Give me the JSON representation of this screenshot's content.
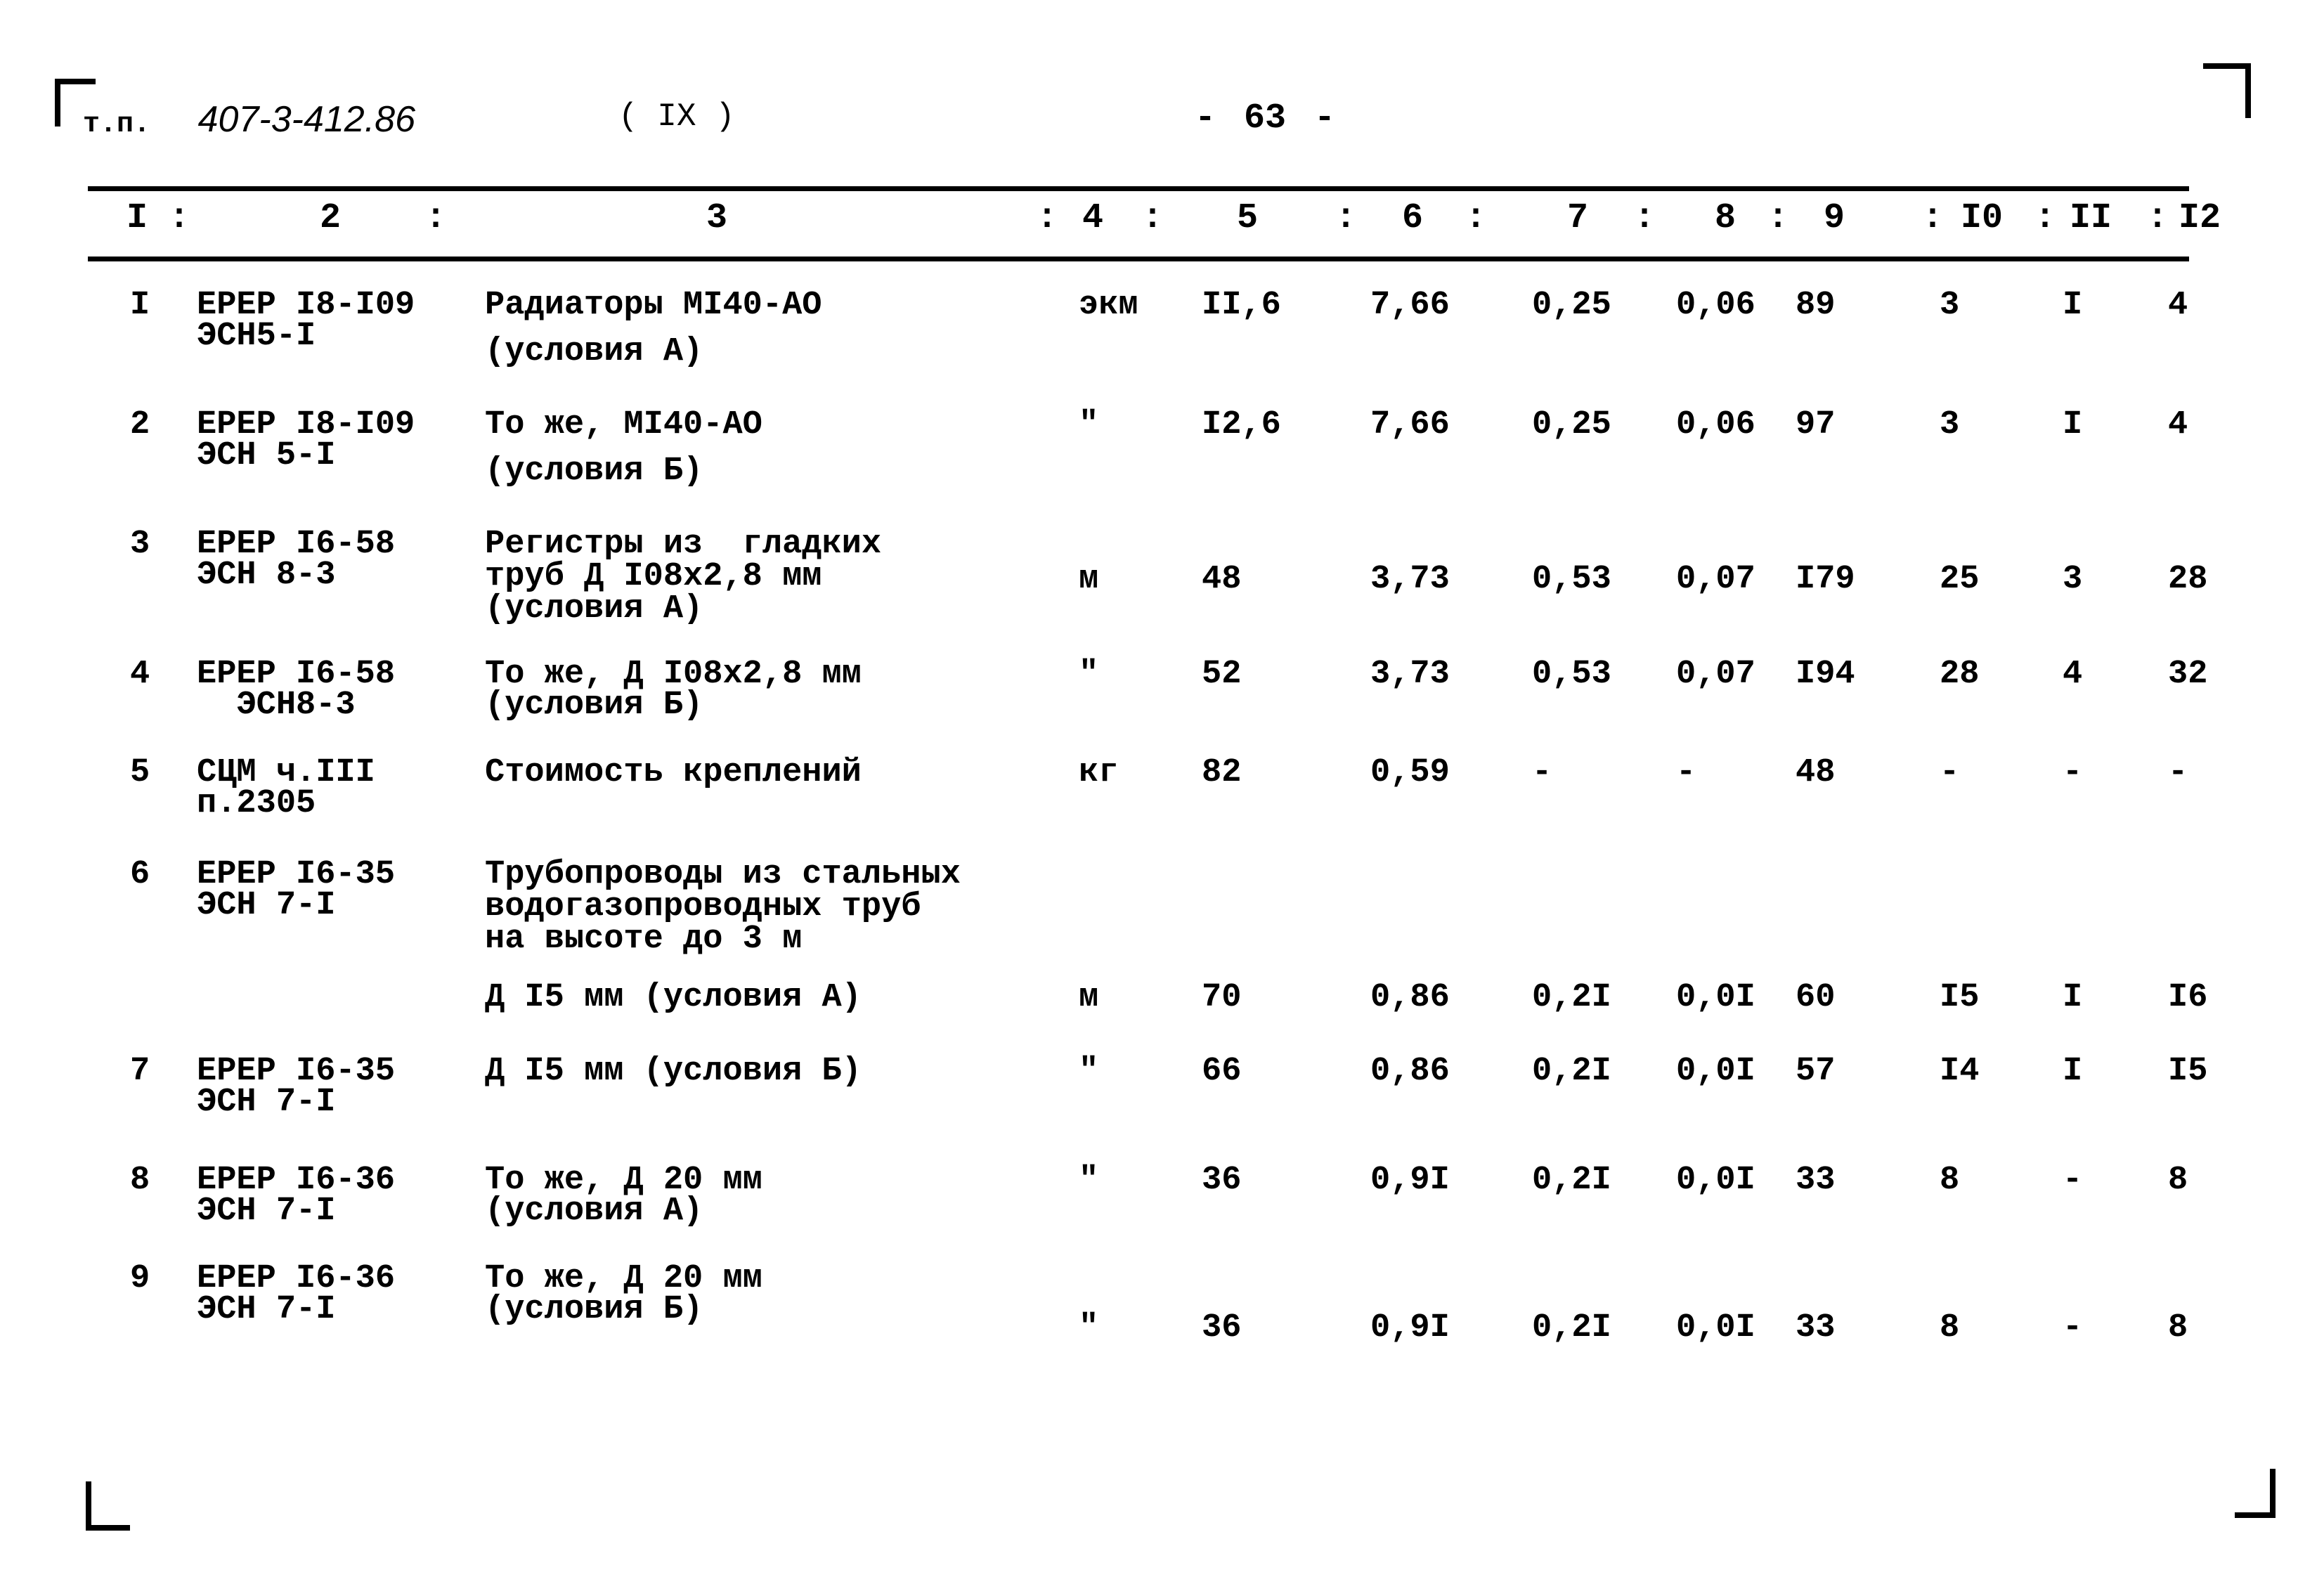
{
  "header": {
    "doc_prefix": "т.п.",
    "doc_number": "407-3-412.86",
    "section": "( IX )",
    "page_number": "63",
    "dash": "-"
  },
  "table": {
    "columns": [
      "I",
      "2",
      "3",
      "4",
      "5",
      "6",
      "7",
      "8",
      "9",
      "I0",
      "II",
      "I2"
    ],
    "column_separator": ":",
    "rows": [
      {
        "n": "I",
        "ref": [
          "ЕРЕР I8-I09",
          "ЭСН5-I"
        ],
        "desc": [
          "Радиаторы МI40-АО",
          "(условия А)"
        ],
        "unit": "экм",
        "c5": "II,6",
        "c6": "7,66",
        "c7": "0,25",
        "c8": "0,06",
        "c9": "89",
        "c10": "3",
        "c11": "I",
        "c12": "4"
      },
      {
        "n": "2",
        "ref": [
          "ЕРЕР I8-I09",
          "ЭСН 5-I"
        ],
        "desc": [
          "То же, МI40-АО",
          "(условия Б)"
        ],
        "unit": "\"",
        "c5": "I2,6",
        "c6": "7,66",
        "c7": "0,25",
        "c8": "0,06",
        "c9": "97",
        "c10": "3",
        "c11": "I",
        "c12": "4"
      },
      {
        "n": "3",
        "ref": [
          "ЕРЕР I6-58",
          "ЭСН 8-3"
        ],
        "desc": [
          "Регистры из  гладких",
          "труб Д I08x2,8 мм",
          "(условия А)"
        ],
        "unit": "м",
        "c5": "48",
        "c6": "3,73",
        "c7": "0,53",
        "c8": "0,07",
        "c9": "I79",
        "c10": "25",
        "c11": "3",
        "c12": "28"
      },
      {
        "n": "4",
        "ref": [
          "ЕРЕР I6-58",
          "  ЭСН8-3"
        ],
        "desc": [
          "То же, Д I08x2,8 мм",
          "(условия Б)"
        ],
        "unit": "\"",
        "c5": "52",
        "c6": "3,73",
        "c7": "0,53",
        "c8": "0,07",
        "c9": "I94",
        "c10": "28",
        "c11": "4",
        "c12": "32"
      },
      {
        "n": "5",
        "ref": [
          "СЦМ ч.III",
          "п.2305"
        ],
        "desc": [
          "Стоимость креплений"
        ],
        "unit": "кг",
        "c5": "82",
        "c6": "0,59",
        "c7": "-",
        "c8": "-",
        "c9": "48",
        "c10": "-",
        "c11": "-",
        "c12": "-"
      },
      {
        "n": "6",
        "ref": [
          "ЕРЕР I6-35",
          "ЭСН 7-I"
        ],
        "desc": [
          "Трубопроводы из стальных",
          "водогазопроводных труб",
          "на высоте до 3 м",
          "Д I5 мм (условия А)"
        ],
        "unit": "м",
        "c5": "70",
        "c6": "0,86",
        "c7": "0,2I",
        "c8": "0,0I",
        "c9": "60",
        "c10": "I5",
        "c11": "I",
        "c12": "I6"
      },
      {
        "n": "7",
        "ref": [
          "ЕРЕР I6-35",
          "ЭСН 7-I"
        ],
        "desc": [
          "Д I5 мм (условия Б)"
        ],
        "unit": "\"",
        "c5": "66",
        "c6": "0,86",
        "c7": "0,2I",
        "c8": "0,0I",
        "c9": "57",
        "c10": "I4",
        "c11": "I",
        "c12": "I5"
      },
      {
        "n": "8",
        "ref": [
          "ЕРЕР I6-36",
          "ЭСН 7-I"
        ],
        "desc": [
          "То же, Д 20 мм",
          "(условия А)"
        ],
        "unit": "\"",
        "c5": "36",
        "c6": "0,9I",
        "c7": "0,2I",
        "c8": "0,0I",
        "c9": "33",
        "c10": "8",
        "c11": "-",
        "c12": "8"
      },
      {
        "n": "9",
        "ref": [
          "ЕРЕР I6-36",
          "ЭСН 7-I"
        ],
        "desc": [
          "То же, Д 20 мм",
          "(условия Б)"
        ],
        "unit": "\"",
        "c5": "36",
        "c6": "0,9I",
        "c7": "0,2I",
        "c8": "0,0I",
        "c9": "33",
        "c10": "8",
        "c11": "-",
        "c12": "8"
      }
    ]
  }
}
